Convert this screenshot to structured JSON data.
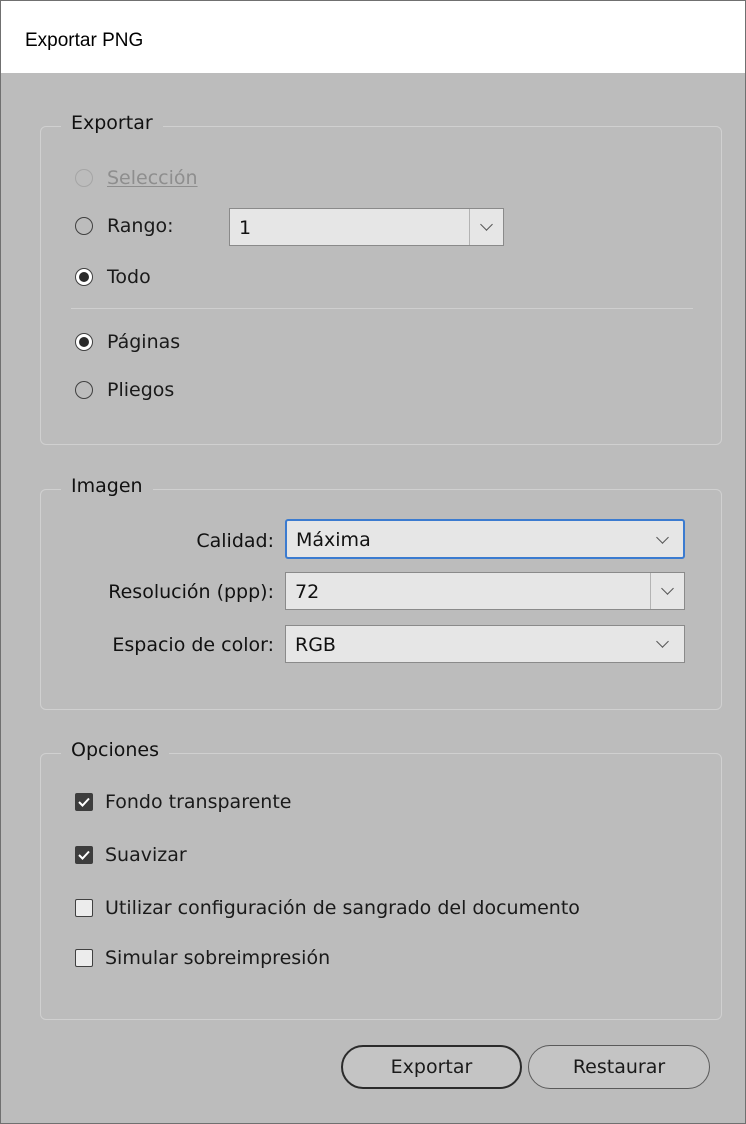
{
  "window": {
    "title": "Exportar PNG"
  },
  "export_group": {
    "legend": "Exportar",
    "seleccion": {
      "label": "Selección",
      "enabled": false,
      "checked": false
    },
    "rango": {
      "label": "Rango:",
      "checked": false,
      "value": "1"
    },
    "todo": {
      "label": "Todo",
      "checked": true
    },
    "paginas": {
      "label": "Páginas",
      "checked": true
    },
    "pliegos": {
      "label": "Pliegos",
      "checked": false
    }
  },
  "image_group": {
    "legend": "Imagen",
    "calidad": {
      "label": "Calidad:",
      "value": "Máxima"
    },
    "resolucion": {
      "label": "Resolución (ppp):",
      "value": "72"
    },
    "espacio": {
      "label": "Espacio de color:",
      "value": "RGB"
    }
  },
  "options_group": {
    "legend": "Opciones",
    "fondo": {
      "label": "Fondo transparente",
      "checked": true
    },
    "suavizar": {
      "label": "Suavizar",
      "checked": true
    },
    "sangrado": {
      "label": "Utilizar configuración de sangrado del documento",
      "checked": false
    },
    "sobreimpresion": {
      "label": "Simular sobreimpresión",
      "checked": false
    }
  },
  "buttons": {
    "export": "Exportar",
    "reset": "Restaurar"
  }
}
